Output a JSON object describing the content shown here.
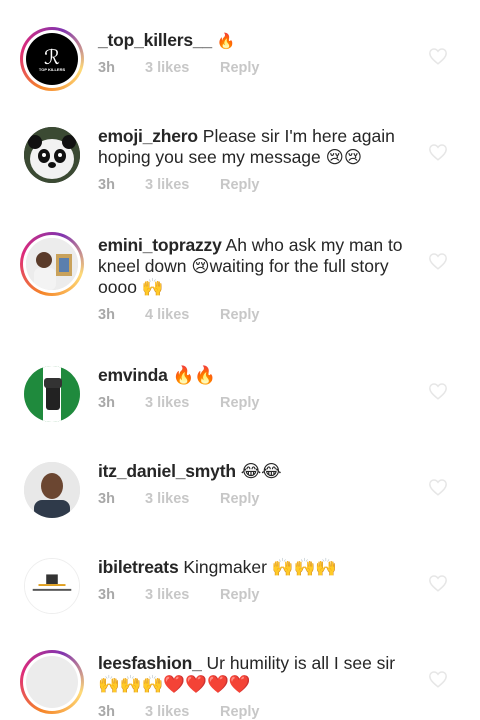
{
  "comments": [
    {
      "username": "_top_killers__",
      "text": " 🔥",
      "time": "3h",
      "likes": "3 likes",
      "reply": "Reply",
      "avatar_text": "TOP KILLERS"
    },
    {
      "username": "emoji_zhero",
      "text": " Please sir I'm here again hoping you see my message 😢😢",
      "time": "3h",
      "likes": "3 likes",
      "reply": "Reply"
    },
    {
      "username": "emini_toprazzy",
      "text": " Ah who ask my man to kneel down 😢waiting for the full story oooo 🙌",
      "time": "3h",
      "likes": "4 likes",
      "reply": "Reply"
    },
    {
      "username": "emvinda",
      "text": " 🔥🔥",
      "time": "3h",
      "likes": "3 likes",
      "reply": "Reply"
    },
    {
      "username": "itz_daniel_smyth",
      "text": " 😂😂",
      "time": "3h",
      "likes": "3 likes",
      "reply": "Reply"
    },
    {
      "username": "ibiletreats",
      "text": " Kingmaker 🙌🙌🙌",
      "time": "3h",
      "likes": "3 likes",
      "reply": "Reply"
    },
    {
      "username": "leesfashion_",
      "text": " Ur humility is all I see sir 🙌🙌🙌❤️❤️❤️❤️",
      "time": "3h",
      "likes": "3 likes",
      "reply": "Reply"
    }
  ],
  "colors": {
    "meta_gray": "#c7c7c7",
    "text": "#262626",
    "ring_start": "#f58529",
    "ring_end": "#dd2a7b"
  }
}
